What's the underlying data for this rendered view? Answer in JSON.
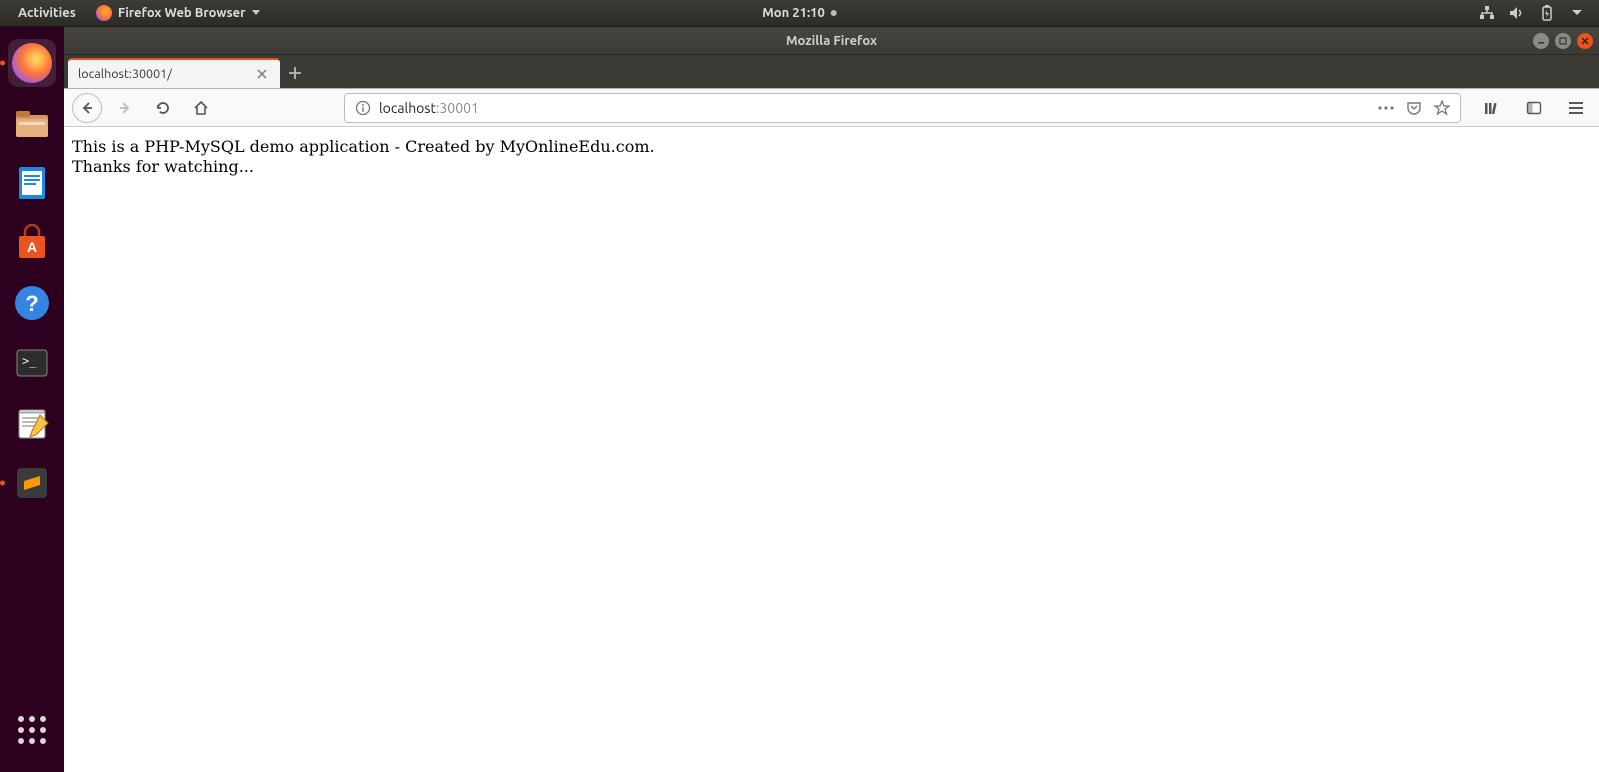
{
  "top_panel": {
    "activities": "Activities",
    "app_menu": "Firefox Web Browser",
    "clock": "Mon 21:10"
  },
  "window": {
    "title": "Mozilla Firefox"
  },
  "tab": {
    "title": "localhost:30001/"
  },
  "url": {
    "host": "localhost",
    "port": ":30001"
  },
  "page": {
    "line1": "This is a PHP-MySQL demo application - Created by MyOnlineEdu.com.",
    "line2": "Thanks for watching..."
  }
}
